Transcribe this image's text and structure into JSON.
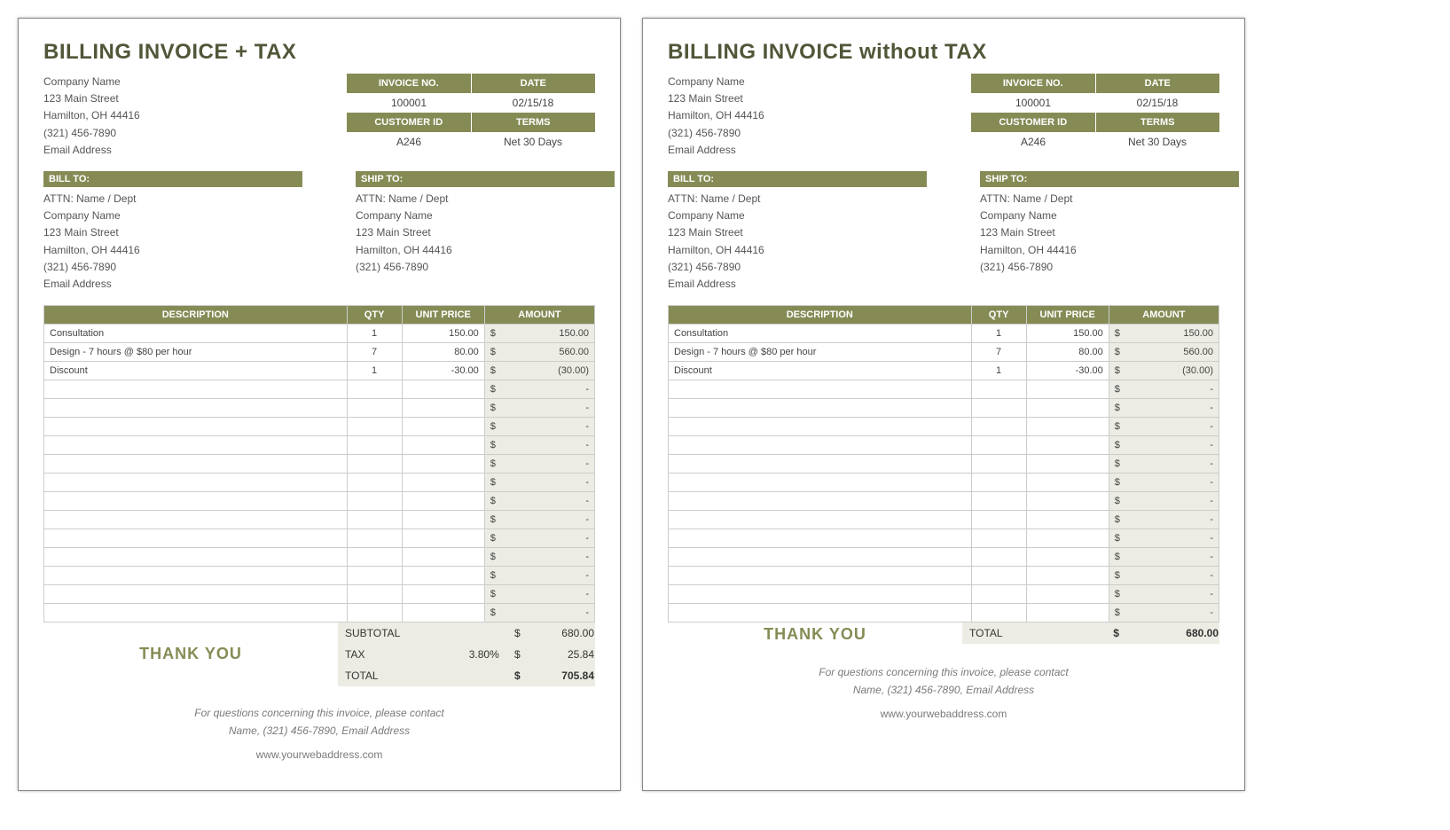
{
  "left": {
    "title": "BILLING INVOICE + TAX",
    "company": {
      "name": "Company Name",
      "street": "123 Main Street",
      "city": "Hamilton, OH  44416",
      "phone": "(321) 456-7890",
      "email": "Email Address"
    },
    "meta": {
      "h_invoice": "INVOICE NO.",
      "h_date": "DATE",
      "invoice": "100001",
      "date": "02/15/18",
      "h_customer": "CUSTOMER ID",
      "h_terms": "TERMS",
      "customer": "A246",
      "terms": "Net 30 Days"
    },
    "billto_h": "BILL TO:",
    "shipto_h": "SHIP TO:",
    "billto": {
      "attn": "ATTN: Name / Dept",
      "name": "Company Name",
      "street": "123 Main Street",
      "city": "Hamilton, OH  44416",
      "phone": "(321) 456-7890",
      "email": "Email Address"
    },
    "shipto": {
      "attn": "ATTN: Name / Dept",
      "name": "Company Name",
      "street": "123 Main Street",
      "city": "Hamilton, OH  44416",
      "phone": "(321) 456-7890"
    },
    "cols": {
      "desc": "DESCRIPTION",
      "qty": "QTY",
      "price": "UNIT PRICE",
      "amt": "AMOUNT"
    },
    "rows": [
      {
        "desc": "Consultation",
        "qty": "1",
        "price": "150.00",
        "amt": "150.00"
      },
      {
        "desc": "Design - 7 hours @ $80 per hour",
        "qty": "7",
        "price": "80.00",
        "amt": "560.00"
      },
      {
        "desc": "Discount",
        "qty": "1",
        "price": "-30.00",
        "amt": "(30.00)"
      }
    ],
    "blank_rows": 13,
    "thanks": "THANK YOU",
    "totals": {
      "subtotal_l": "SUBTOTAL",
      "subtotal_v": "680.00",
      "tax_l": "TAX",
      "tax_rate": "3.80%",
      "tax_v": "25.84",
      "total_l": "TOTAL",
      "total_v": "705.84"
    },
    "footer": {
      "l1": "For questions concerning this invoice, please contact",
      "l2": "Name, (321) 456-7890, Email Address",
      "web": "www.yourwebaddress.com"
    }
  },
  "right": {
    "title": "BILLING INVOICE without TAX",
    "company": {
      "name": "Company Name",
      "street": "123 Main Street",
      "city": "Hamilton, OH  44416",
      "phone": "(321) 456-7890",
      "email": "Email Address"
    },
    "meta": {
      "h_invoice": "INVOICE NO.",
      "h_date": "DATE",
      "invoice": "100001",
      "date": "02/15/18",
      "h_customer": "CUSTOMER ID",
      "h_terms": "TERMS",
      "customer": "A246",
      "terms": "Net 30 Days"
    },
    "billto_h": "BILL TO:",
    "shipto_h": "SHIP TO:",
    "billto": {
      "attn": "ATTN: Name / Dept",
      "name": "Company Name",
      "street": "123 Main Street",
      "city": "Hamilton, OH  44416",
      "phone": "(321) 456-7890",
      "email": "Email Address"
    },
    "shipto": {
      "attn": "ATTN: Name / Dept",
      "name": "Company Name",
      "street": "123 Main Street",
      "city": "Hamilton, OH  44416",
      "phone": "(321) 456-7890"
    },
    "cols": {
      "desc": "DESCRIPTION",
      "qty": "QTY",
      "price": "UNIT PRICE",
      "amt": "AMOUNT"
    },
    "rows": [
      {
        "desc": "Consultation",
        "qty": "1",
        "price": "150.00",
        "amt": "150.00"
      },
      {
        "desc": "Design - 7 hours @ $80 per hour",
        "qty": "7",
        "price": "80.00",
        "amt": "560.00"
      },
      {
        "desc": "Discount",
        "qty": "1",
        "price": "-30.00",
        "amt": "(30.00)"
      }
    ],
    "blank_rows": 13,
    "thanks": "THANK YOU",
    "totals": {
      "total_l": "TOTAL",
      "total_v": "680.00"
    },
    "footer": {
      "l1": "For questions concerning this invoice, please contact",
      "l2": "Name, (321) 456-7890, Email Address",
      "web": "www.yourwebaddress.com"
    }
  }
}
